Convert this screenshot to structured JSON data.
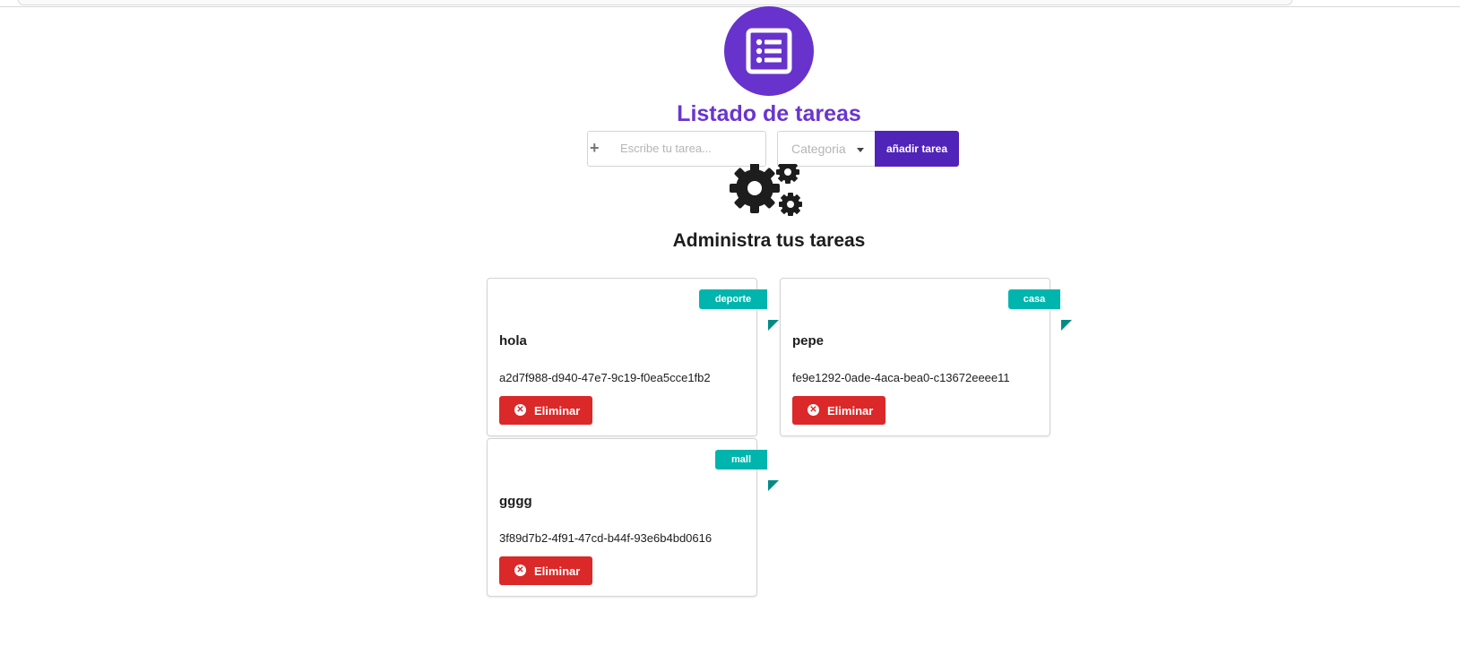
{
  "header": {
    "title": "Listado de tareas",
    "logo_icon": "list-icon",
    "accent_color": "#6733cc"
  },
  "form": {
    "task_placeholder": "Escribe tu tarea...",
    "task_value": "",
    "category_placeholder": "Categoria",
    "add_button_label": "añadir tarea",
    "plus_icon": "+"
  },
  "section": {
    "title": "Administra tus tareas",
    "icon": "gears-icon"
  },
  "tasks": [
    {
      "category": "deporte",
      "title": "hola",
      "id": "a2d7f988-d940-47e7-9c19-f0ea5cce1fb2",
      "delete_label": "Eliminar"
    },
    {
      "category": "casa",
      "title": "pepe",
      "id": "fe9e1292-0ade-4aca-bea0-c13672eeee11",
      "delete_label": "Eliminar"
    },
    {
      "category": "mall",
      "title": "gggg",
      "id": "3f89d7b2-4f91-47cd-b44f-93e6b4bd0616",
      "delete_label": "Eliminar"
    }
  ],
  "colors": {
    "ribbon": "#00b5ad",
    "delete": "#db2828",
    "add_button": "#5024b8"
  }
}
